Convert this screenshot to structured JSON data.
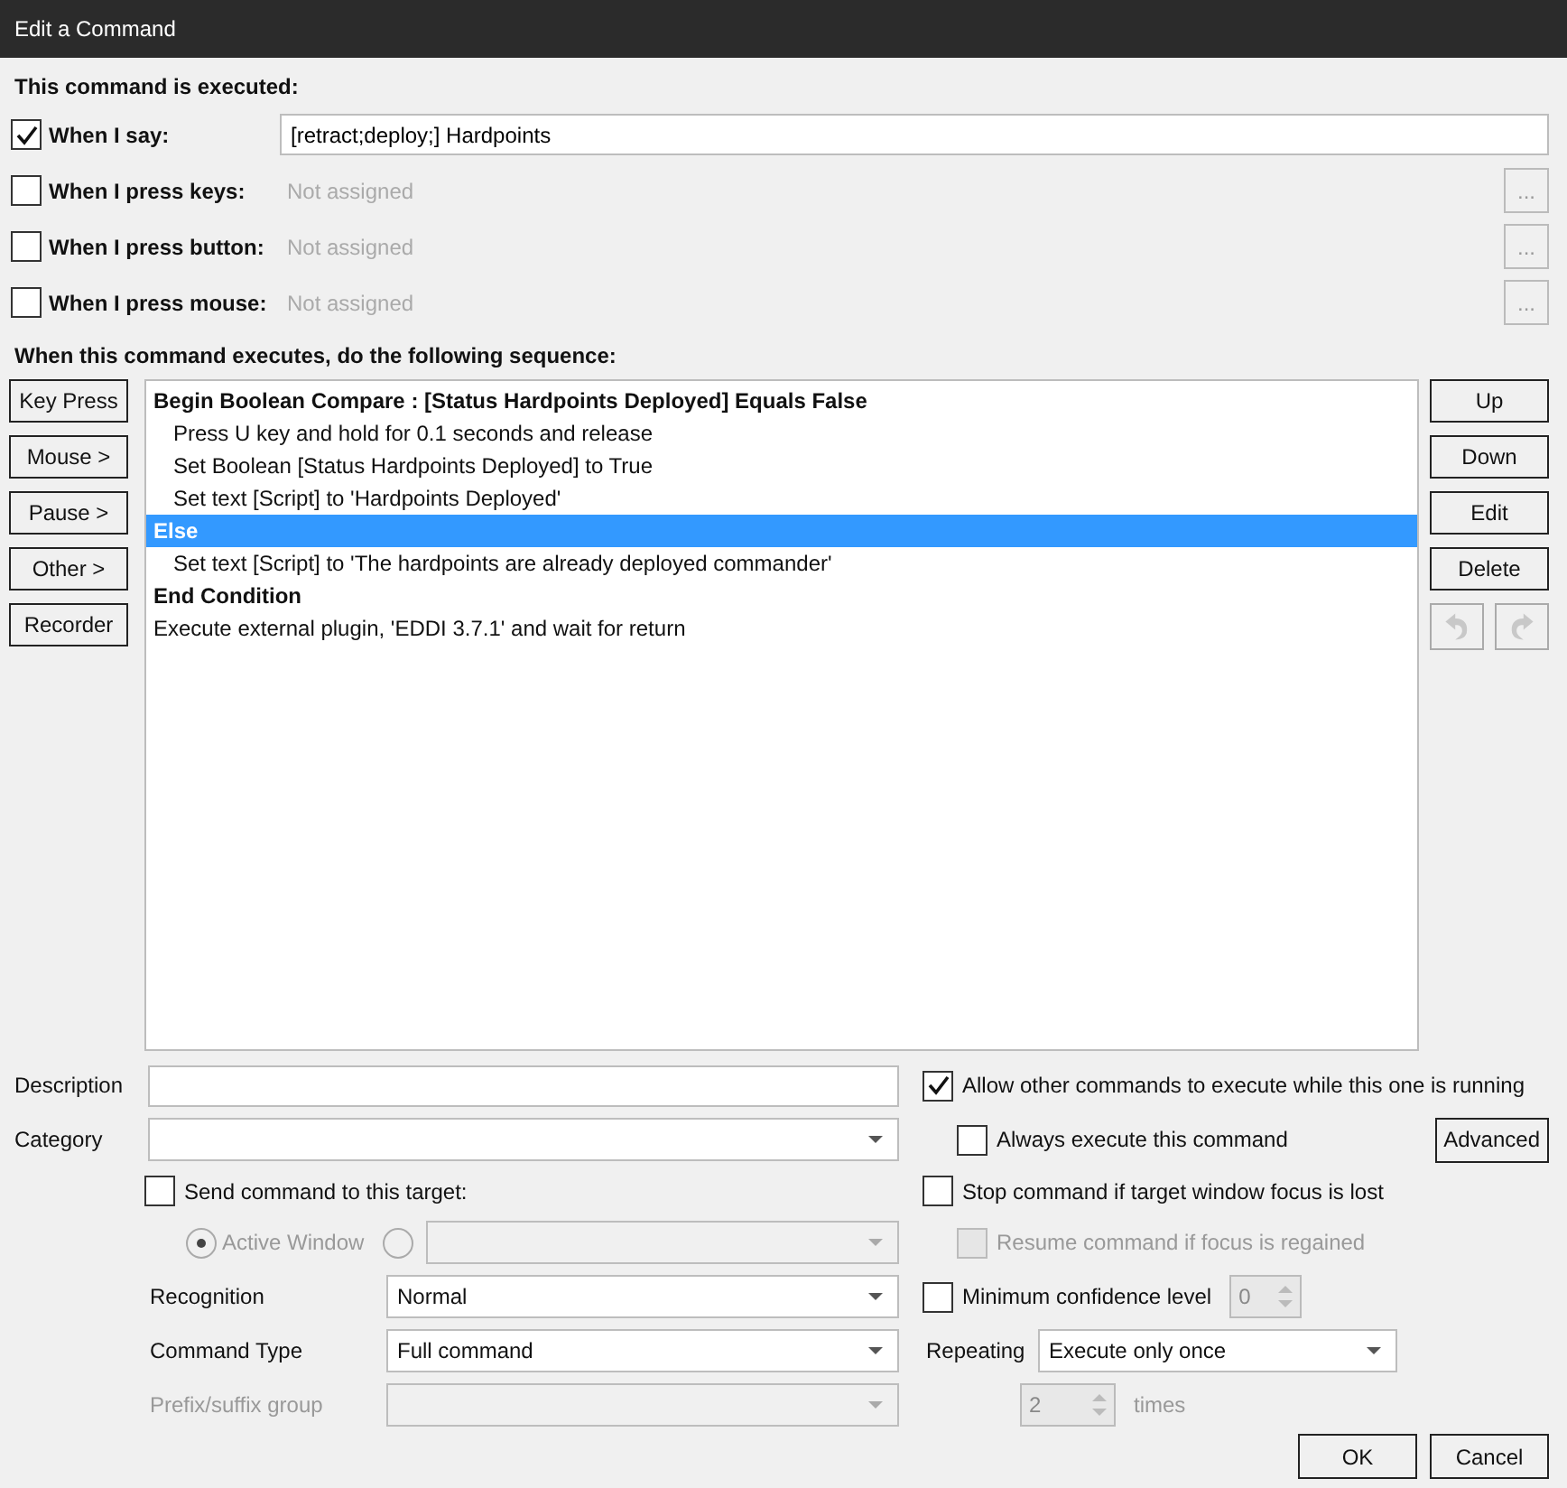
{
  "window": {
    "title": "Edit a Command"
  },
  "triggers_heading": "This command is executed:",
  "triggers": [
    {
      "label": "When I say:",
      "checked": true,
      "kind": "phrase",
      "value": "[retract;deploy;] Hardpoints"
    },
    {
      "label": "When I press keys:",
      "checked": false,
      "kind": "assign",
      "placeholder": "Not assigned",
      "button": "..."
    },
    {
      "label": "When I press button:",
      "checked": false,
      "kind": "assign",
      "placeholder": "Not assigned",
      "button": "..."
    },
    {
      "label": "When I press mouse:",
      "checked": false,
      "kind": "assign",
      "placeholder": "Not assigned",
      "button": "..."
    }
  ],
  "sequence_heading": "When this command executes, do the following sequence:",
  "action_buttons": [
    "Key Press",
    "Mouse >",
    "Pause >",
    "Other >",
    "Recorder"
  ],
  "sequence": [
    {
      "text": "Begin Boolean Compare : [Status Hardpoints Deployed] Equals False",
      "kind": "block",
      "selected": false,
      "children": [
        {
          "text": "Press U key and hold for 0.1 seconds and release",
          "selected": false
        },
        {
          "text": "Set Boolean [Status Hardpoints Deployed] to True",
          "selected": false
        },
        {
          "text": "Set text [Script] to 'Hardpoints Deployed'",
          "selected": false
        }
      ]
    },
    {
      "text": "Else",
      "kind": "block",
      "selected": true,
      "children": [
        {
          "text": "Set text [Script] to 'The hardpoints are already deployed commander'",
          "selected": false
        }
      ]
    },
    {
      "text": "End Condition",
      "kind": "block",
      "selected": false
    },
    {
      "text": "Execute external plugin, 'EDDI 3.7.1' and wait for return",
      "kind": "action",
      "selected": false
    }
  ],
  "order_buttons": [
    "Up",
    "Down",
    "Edit",
    "Delete"
  ],
  "history_buttons": [
    {
      "kind": "undo",
      "disabled": true
    },
    {
      "kind": "redo",
      "disabled": true
    }
  ],
  "description": {
    "label": "Description"
  },
  "category": {
    "label": "Category"
  },
  "send_target": {
    "label": "Send command to this target:",
    "checked": false
  },
  "target_options": [
    {
      "label": "Active Window",
      "selected": true,
      "disabled": true
    },
    {
      "selected": false,
      "disabled": true
    }
  ],
  "recognition": {
    "label": "Recognition",
    "value": "Normal",
    "disabled": false
  },
  "command_type": {
    "label": "Command Type",
    "value": "Full command",
    "disabled": false
  },
  "prefix_group": {
    "label": "Prefix/suffix group",
    "disabled": true
  },
  "allow_others": {
    "label": "Allow other commands to execute while this one is running",
    "checked": true,
    "disabled": false
  },
  "always_execute": {
    "label": "Always execute this command",
    "checked": false,
    "disabled": false
  },
  "advanced_button": "Advanced",
  "stop_on_focus": {
    "label": "Stop command if target window focus is lost",
    "checked": false,
    "disabled": false
  },
  "resume_on_focus": {
    "label": "Resume command if focus is regained",
    "checked": false,
    "disabled": true
  },
  "min_confidence": {
    "label": "Minimum confidence level",
    "checked": false,
    "disabled": false,
    "value": "0"
  },
  "repeating": {
    "label": "Repeating",
    "value": "Execute only once",
    "times_value": "2",
    "times_label": "times"
  },
  "dialog_buttons": [
    "OK",
    "Cancel"
  ]
}
